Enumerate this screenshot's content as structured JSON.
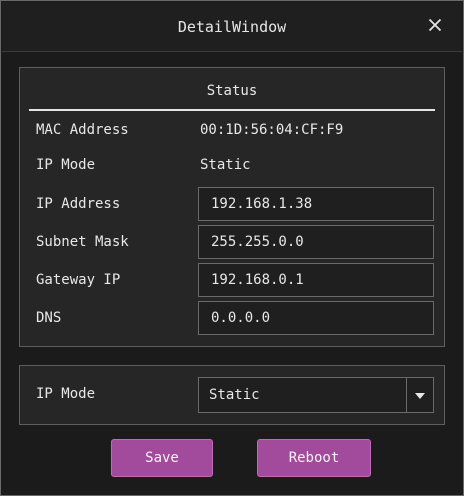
{
  "window": {
    "title": "DetailWindow",
    "close_icon": "close-icon"
  },
  "status": {
    "title": "Status",
    "mac_label": "MAC Address",
    "mac_value": "00:1D:56:04:CF:F9",
    "ip_mode_label": "IP Mode",
    "ip_mode_value": "Static",
    "ip_address_label": "IP Address",
    "ip_address_value": "192.168.1.38",
    "subnet_label": "Subnet Mask",
    "subnet_value": "255.255.0.0",
    "gateway_label": "Gateway IP",
    "gateway_value": "192.168.0.1",
    "dns_label": "DNS",
    "dns_value": "0.0.0.0"
  },
  "mode": {
    "label": "IP Mode",
    "selected": "Static",
    "dropdown_icon": "chevron-down-icon"
  },
  "actions": {
    "save_label": "Save",
    "reboot_label": "Reboot"
  },
  "colors": {
    "window_bg": "#1b1b1b",
    "panel_bg": "#262626",
    "border": "#6a6a6a",
    "accent_button": "#a24a9b",
    "text": "#e8e8e8"
  }
}
